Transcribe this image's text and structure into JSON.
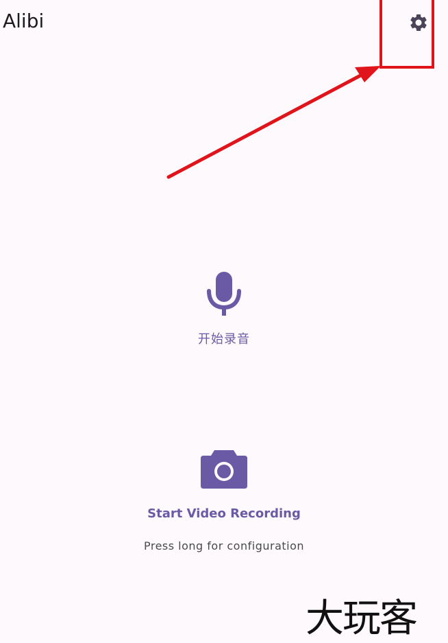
{
  "app": {
    "title": "Alibi"
  },
  "toolbar": {
    "settings_icon": "gear-icon"
  },
  "audio": {
    "icon": "microphone-icon",
    "label": "开始录音"
  },
  "video": {
    "icon": "camera-icon",
    "label": "Start Video Recording",
    "hint": "Press long for configuration"
  },
  "watermark": {
    "text": "大玩客"
  },
  "colors": {
    "background": "#fdf9fd",
    "accent": "#6a5aa6",
    "annotation": "#e0141b"
  }
}
